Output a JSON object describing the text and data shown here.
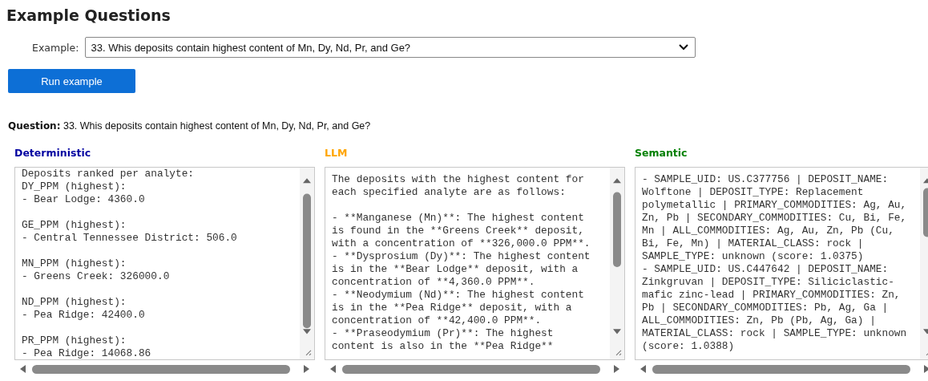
{
  "title": "Example Questions",
  "example": {
    "label": "Example:",
    "value": "33. Whis deposits contain highest content of Mn, Dy, Nd, Pr, and Ge?"
  },
  "run_button": "Run example",
  "question": {
    "label": "Question:",
    "text": "33. Whis deposits contain highest content of Mn, Dy, Nd, Pr, and Ge?"
  },
  "panels": [
    {
      "title": "Deterministic",
      "color": "#0000a0",
      "blocks": [
        [
          "Deposits ranked per analyte:",
          "DY_PPM (highest):",
          "- Bear Lodge: 4360.0"
        ],
        [
          "GE_PPM (highest):",
          "- Central Tennessee District: 506.0"
        ],
        [
          "MN_PPM (highest):",
          "- Greens Creek: 326000.0"
        ],
        [
          "ND_PPM (highest):",
          "- Pea Ridge: 42400.0"
        ],
        [
          "PR_PPM (highest):",
          "- Pea Ridge: 14068.86"
        ]
      ]
    },
    {
      "title": "LLM",
      "color": "#ffa500",
      "blocks": [
        [
          "The deposits with the highest content for",
          "each specified analyte are as follows:"
        ],
        [
          "- **Manganese (Mn)**: The highest content",
          "is found in the **Greens Creek** deposit,",
          "with a concentration of **326,000.0 PPM**.",
          "- **Dysprosium (Dy)**: The highest content",
          "is in the **Bear Lodge** deposit, with a",
          "concentration of **4,360.0 PPM**.",
          "- **Neodymium (Nd)**: The highest content",
          "is in the **Pea Ridge** deposit, with a",
          "concentration of **42,400.0 PPM**.",
          "- **Praseodymium (Pr)**: The highest",
          "content is also in the **Pea Ridge**"
        ]
      ]
    },
    {
      "title": "Semantic",
      "color": "#008000",
      "blocks": [
        [
          "- SAMPLE_UID: US.C377756 | DEPOSIT_NAME:",
          "Wolftone | DEPOSIT_TYPE: Replacement",
          "polymetallic | PRIMARY_COMMODITIES: Ag, Au,",
          "Zn, Pb | SECONDARY_COMMODITIES: Cu, Bi, Fe,",
          "Mn | ALL_COMMODITIES: Ag, Au, Zn, Pb (Cu,",
          "Bi, Fe, Mn) | MATERIAL_CLASS: rock |",
          "SAMPLE_TYPE: unknown (score: 1.0375)",
          "- SAMPLE_UID: US.C447642 | DEPOSIT_NAME:",
          "Zinkgruvan | DEPOSIT_TYPE: Siliciclastic-",
          "mafic zinc-lead | PRIMARY_COMMODITIES: Zn,",
          "Pb | SECONDARY_COMMODITIES: Pb, Ag, Ga |",
          "ALL_COMMODITIES: Zn, Pb (Pb, Ag, Ga) |",
          "MATERIAL_CLASS: rock | SAMPLE_TYPE: unknown",
          "(score: 1.0388)"
        ]
      ]
    }
  ]
}
